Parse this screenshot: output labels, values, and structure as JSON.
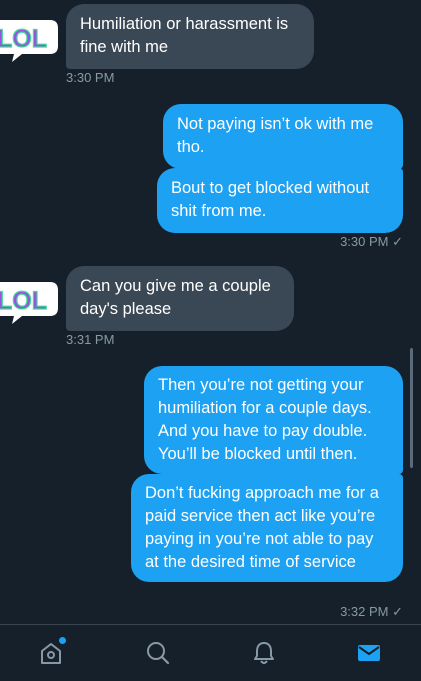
{
  "messages": [
    {
      "text": "Humiliation or harassment is fine with me",
      "timestamp": "3:30 PM"
    },
    {
      "text": "Not paying isn’t ok with me tho."
    },
    {
      "text": "Bout to get blocked without shit from me.",
      "timestamp": "3:30 PM ✓"
    },
    {
      "text": "Can you give me a couple day's please",
      "timestamp": "3:31 PM"
    },
    {
      "text": "Then you’re not getting your humiliation for a couple days. And you have to pay double. You’ll be blocked until then."
    },
    {
      "text": "Don’t fucking approach me for a paid service then act like you’re paying in you’re not able to pay at the desired time of service",
      "timestamp": "3:32 PM ✓"
    }
  ],
  "avatar_text": "LOL",
  "tabs": [
    "home-icon",
    "search-icon",
    "notifications-icon",
    "messages-icon"
  ],
  "colors": {
    "background": "#15202b",
    "incoming": "#3a4754",
    "outgoing": "#1da1f2",
    "accent": "#1da1f2"
  }
}
